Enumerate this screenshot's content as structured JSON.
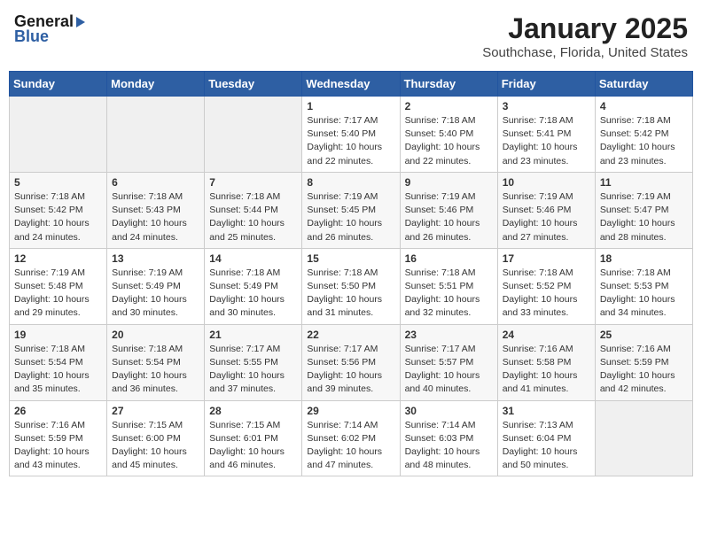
{
  "logo": {
    "general": "General",
    "blue": "Blue"
  },
  "title": "January 2025",
  "subtitle": "Southchase, Florida, United States",
  "days_of_week": [
    "Sunday",
    "Monday",
    "Tuesday",
    "Wednesday",
    "Thursday",
    "Friday",
    "Saturday"
  ],
  "weeks": [
    [
      {
        "day": "",
        "sunrise": "",
        "sunset": "",
        "daylight": ""
      },
      {
        "day": "",
        "sunrise": "",
        "sunset": "",
        "daylight": ""
      },
      {
        "day": "",
        "sunrise": "",
        "sunset": "",
        "daylight": ""
      },
      {
        "day": "1",
        "sunrise": "Sunrise: 7:17 AM",
        "sunset": "Sunset: 5:40 PM",
        "daylight": "Daylight: 10 hours and 22 minutes."
      },
      {
        "day": "2",
        "sunrise": "Sunrise: 7:18 AM",
        "sunset": "Sunset: 5:40 PM",
        "daylight": "Daylight: 10 hours and 22 minutes."
      },
      {
        "day": "3",
        "sunrise": "Sunrise: 7:18 AM",
        "sunset": "Sunset: 5:41 PM",
        "daylight": "Daylight: 10 hours and 23 minutes."
      },
      {
        "day": "4",
        "sunrise": "Sunrise: 7:18 AM",
        "sunset": "Sunset: 5:42 PM",
        "daylight": "Daylight: 10 hours and 23 minutes."
      }
    ],
    [
      {
        "day": "5",
        "sunrise": "Sunrise: 7:18 AM",
        "sunset": "Sunset: 5:42 PM",
        "daylight": "Daylight: 10 hours and 24 minutes."
      },
      {
        "day": "6",
        "sunrise": "Sunrise: 7:18 AM",
        "sunset": "Sunset: 5:43 PM",
        "daylight": "Daylight: 10 hours and 24 minutes."
      },
      {
        "day": "7",
        "sunrise": "Sunrise: 7:18 AM",
        "sunset": "Sunset: 5:44 PM",
        "daylight": "Daylight: 10 hours and 25 minutes."
      },
      {
        "day": "8",
        "sunrise": "Sunrise: 7:19 AM",
        "sunset": "Sunset: 5:45 PM",
        "daylight": "Daylight: 10 hours and 26 minutes."
      },
      {
        "day": "9",
        "sunrise": "Sunrise: 7:19 AM",
        "sunset": "Sunset: 5:46 PM",
        "daylight": "Daylight: 10 hours and 26 minutes."
      },
      {
        "day": "10",
        "sunrise": "Sunrise: 7:19 AM",
        "sunset": "Sunset: 5:46 PM",
        "daylight": "Daylight: 10 hours and 27 minutes."
      },
      {
        "day": "11",
        "sunrise": "Sunrise: 7:19 AM",
        "sunset": "Sunset: 5:47 PM",
        "daylight": "Daylight: 10 hours and 28 minutes."
      }
    ],
    [
      {
        "day": "12",
        "sunrise": "Sunrise: 7:19 AM",
        "sunset": "Sunset: 5:48 PM",
        "daylight": "Daylight: 10 hours and 29 minutes."
      },
      {
        "day": "13",
        "sunrise": "Sunrise: 7:19 AM",
        "sunset": "Sunset: 5:49 PM",
        "daylight": "Daylight: 10 hours and 30 minutes."
      },
      {
        "day": "14",
        "sunrise": "Sunrise: 7:18 AM",
        "sunset": "Sunset: 5:49 PM",
        "daylight": "Daylight: 10 hours and 30 minutes."
      },
      {
        "day": "15",
        "sunrise": "Sunrise: 7:18 AM",
        "sunset": "Sunset: 5:50 PM",
        "daylight": "Daylight: 10 hours and 31 minutes."
      },
      {
        "day": "16",
        "sunrise": "Sunrise: 7:18 AM",
        "sunset": "Sunset: 5:51 PM",
        "daylight": "Daylight: 10 hours and 32 minutes."
      },
      {
        "day": "17",
        "sunrise": "Sunrise: 7:18 AM",
        "sunset": "Sunset: 5:52 PM",
        "daylight": "Daylight: 10 hours and 33 minutes."
      },
      {
        "day": "18",
        "sunrise": "Sunrise: 7:18 AM",
        "sunset": "Sunset: 5:53 PM",
        "daylight": "Daylight: 10 hours and 34 minutes."
      }
    ],
    [
      {
        "day": "19",
        "sunrise": "Sunrise: 7:18 AM",
        "sunset": "Sunset: 5:54 PM",
        "daylight": "Daylight: 10 hours and 35 minutes."
      },
      {
        "day": "20",
        "sunrise": "Sunrise: 7:18 AM",
        "sunset": "Sunset: 5:54 PM",
        "daylight": "Daylight: 10 hours and 36 minutes."
      },
      {
        "day": "21",
        "sunrise": "Sunrise: 7:17 AM",
        "sunset": "Sunset: 5:55 PM",
        "daylight": "Daylight: 10 hours and 37 minutes."
      },
      {
        "day": "22",
        "sunrise": "Sunrise: 7:17 AM",
        "sunset": "Sunset: 5:56 PM",
        "daylight": "Daylight: 10 hours and 39 minutes."
      },
      {
        "day": "23",
        "sunrise": "Sunrise: 7:17 AM",
        "sunset": "Sunset: 5:57 PM",
        "daylight": "Daylight: 10 hours and 40 minutes."
      },
      {
        "day": "24",
        "sunrise": "Sunrise: 7:16 AM",
        "sunset": "Sunset: 5:58 PM",
        "daylight": "Daylight: 10 hours and 41 minutes."
      },
      {
        "day": "25",
        "sunrise": "Sunrise: 7:16 AM",
        "sunset": "Sunset: 5:59 PM",
        "daylight": "Daylight: 10 hours and 42 minutes."
      }
    ],
    [
      {
        "day": "26",
        "sunrise": "Sunrise: 7:16 AM",
        "sunset": "Sunset: 5:59 PM",
        "daylight": "Daylight: 10 hours and 43 minutes."
      },
      {
        "day": "27",
        "sunrise": "Sunrise: 7:15 AM",
        "sunset": "Sunset: 6:00 PM",
        "daylight": "Daylight: 10 hours and 45 minutes."
      },
      {
        "day": "28",
        "sunrise": "Sunrise: 7:15 AM",
        "sunset": "Sunset: 6:01 PM",
        "daylight": "Daylight: 10 hours and 46 minutes."
      },
      {
        "day": "29",
        "sunrise": "Sunrise: 7:14 AM",
        "sunset": "Sunset: 6:02 PM",
        "daylight": "Daylight: 10 hours and 47 minutes."
      },
      {
        "day": "30",
        "sunrise": "Sunrise: 7:14 AM",
        "sunset": "Sunset: 6:03 PM",
        "daylight": "Daylight: 10 hours and 48 minutes."
      },
      {
        "day": "31",
        "sunrise": "Sunrise: 7:13 AM",
        "sunset": "Sunset: 6:04 PM",
        "daylight": "Daylight: 10 hours and 50 minutes."
      },
      {
        "day": "",
        "sunrise": "",
        "sunset": "",
        "daylight": ""
      }
    ]
  ]
}
